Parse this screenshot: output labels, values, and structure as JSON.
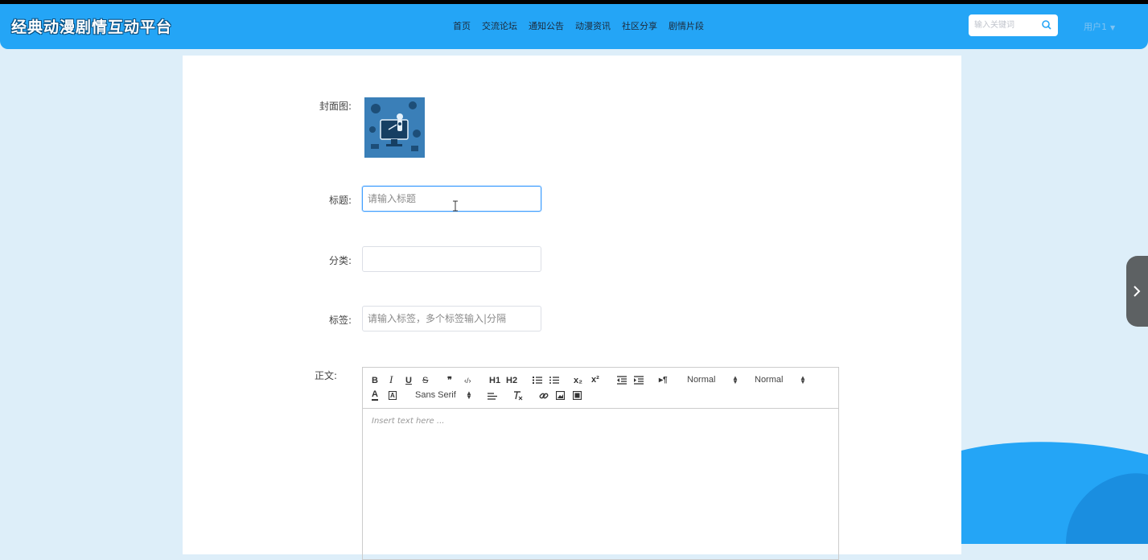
{
  "header": {
    "title": "经典动漫剧情互动平台",
    "nav": [
      "首页",
      "交流论坛",
      "通知公告",
      "动漫资讯",
      "社区分享",
      "剧情片段"
    ],
    "search_placeholder": "输入关键词",
    "user": "用户1"
  },
  "form": {
    "cover_label": "封面图:",
    "title_label": "标题:",
    "title_placeholder": "请输入标题",
    "category_label": "分类:",
    "tags_label": "标签:",
    "tags_placeholder": "请输入标签，多个标签输入|分隔",
    "body_label": "正文:"
  },
  "editor": {
    "toolbar": {
      "bold": "B",
      "italic": "I",
      "underline": "U",
      "strike": "S",
      "blockquote": "❞",
      "code": "‹/›",
      "h1": "H1",
      "h2": "H2",
      "subscript": "x₂",
      "superscript": "x²",
      "rtl": "▸¶",
      "size_value": "Normal",
      "header_value": "Normal",
      "font_value": "Sans Serif",
      "color": "A",
      "background": "A"
    },
    "placeholder": "Insert text here ..."
  },
  "colors": {
    "header": "#24a5f6",
    "page_bg": "#ddeef9",
    "focus": "#409eff"
  }
}
